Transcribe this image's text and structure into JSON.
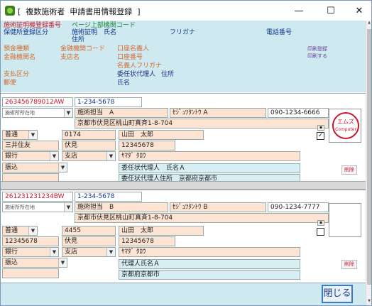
{
  "window": {
    "title": "[  複数施術者  申請書用情報登録  ]",
    "min": "—",
    "max": "☐",
    "close": "✕"
  },
  "header": {
    "r1a": "施術証明機登録番号",
    "r1b": "ページ上部機関コード",
    "r2a": "保健所登録区分",
    "r2b": "施術証明",
    "r2c": "氏名",
    "r2d": "フリガナ",
    "r2e": "電話番号",
    "r3a": "住所",
    "r4a": "預金種類",
    "r4b": "金融機関コード",
    "r4c": "口座名義人",
    "r4d": "印刷登録",
    "r5a": "金融機関名",
    "r5b": "支店名",
    "r5c": "口座番号",
    "r5d": "印刷する",
    "r6a": "名義人フリガナ",
    "r7a": "支払区分",
    "r7b": "委任状代理人",
    "r7c": "住所",
    "r8a": "郵便",
    "r8b": "氏名"
  },
  "records": [
    {
      "reg_no": "263456789012AW",
      "code": "1-234-5678",
      "area": "施術所所在地",
      "name": "施術担当　A",
      "kana": "ｾｼﾞｭﾂﾀﾝﾄｳ A",
      "phone": "090-1234-6666",
      "address": "京都市伏見区桃山町真斉1-8-704",
      "acct_type": "普通",
      "bank_code": "0174",
      "holder": "山田　太郎",
      "bank": "三井住友",
      "branch": "伏見",
      "acct_no": "12345678",
      "fin": "銀行",
      "branch_lbl": "支店",
      "holder_kana": "ﾔﾏﾀﾞ ﾀﾛｳ",
      "pay": "振込",
      "agent_name": "委任状代理人　氏名Ａ",
      "agent_addr": "委任状代理人住所　京都府京都市",
      "seal_top": "エムズ",
      "seal_bottom": "Computer",
      "del": "削除",
      "checked": "✓"
    },
    {
      "reg_no": "261231231234BW",
      "code": "1-234-5678",
      "area": "施術所所在地",
      "name": "施術担当　B",
      "kana": "ｾｼﾞｭﾂﾀﾝﾄｳ B",
      "phone": "090-1234-7777",
      "address": "京都市伏見区桃山町真斉1-8-704",
      "acct_type": "普通",
      "bank_code": "4455",
      "holder": "山田　太郎",
      "bank": "12345678",
      "branch": "伏見",
      "acct_no": "12345678",
      "fin": "銀行",
      "branch_lbl": "支店",
      "holder_kana": "ﾔﾏﾀﾞ ﾀﾛｳ",
      "pay": "振込",
      "agent_name": "代理人氏名Ａ",
      "agent_addr": "京都府京都市",
      "del": "削除",
      "checked": ""
    }
  ],
  "footer": {
    "close": "閉じる"
  },
  "colors": {
    "header_bg": "#cfe9f0",
    "field_pink": "#fde3d1",
    "field_blue": "#d6eef4",
    "seal": "#c8182b"
  }
}
